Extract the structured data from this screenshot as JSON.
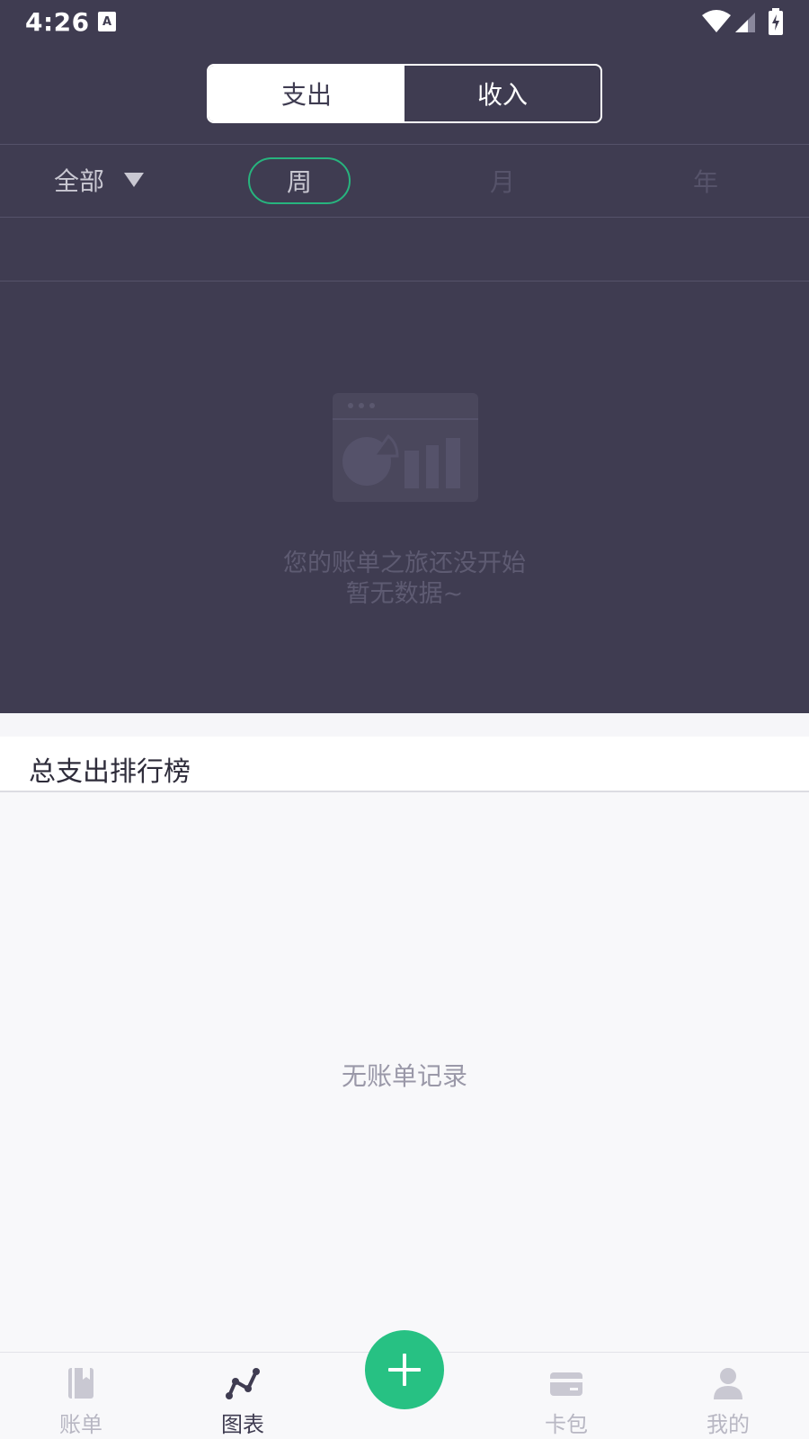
{
  "status_bar": {
    "time": "4:26"
  },
  "toggle": {
    "expense": "支出",
    "income": "收入"
  },
  "filter": {
    "category": "全部",
    "periods": {
      "week": "周",
      "month": "月",
      "year": "年"
    }
  },
  "chart_empty": {
    "line1": "您的账单之旅还没开始",
    "line2": "暂无数据~"
  },
  "ranking": {
    "title": "总支出排行榜",
    "empty": "无账单记录"
  },
  "nav": {
    "bills": "账单",
    "charts": "图表",
    "cards": "卡包",
    "mine": "我的"
  },
  "colors": {
    "dark_bg": "#3f3c51",
    "accent_green": "#27c183"
  }
}
